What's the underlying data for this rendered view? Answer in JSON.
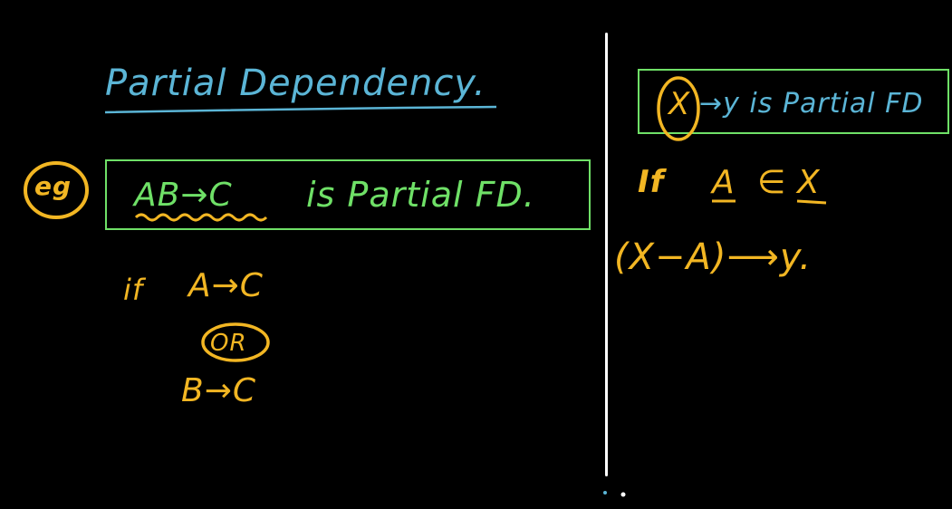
{
  "colors": {
    "background": "#000000",
    "title_blue": "#5bb5d6",
    "statement_green": "#6fe067",
    "note_yellow": "#f2b623",
    "divider_white": "#ffffff"
  },
  "left": {
    "title": "Partial Dependency.",
    "eg_label": "eg",
    "statement_lhs": "AB→C",
    "statement_rest": "is Partial FD.",
    "condition_if": "if",
    "condition_first": "A→C",
    "condition_or": "OR",
    "condition_second": "B→C"
  },
  "right": {
    "rule_x": "X",
    "rule_rest": "→y is Partial FD",
    "if_label": "If",
    "if_a": "A",
    "if_in": "∈",
    "if_x": "X",
    "implication": "(X−A)⟶y."
  }
}
